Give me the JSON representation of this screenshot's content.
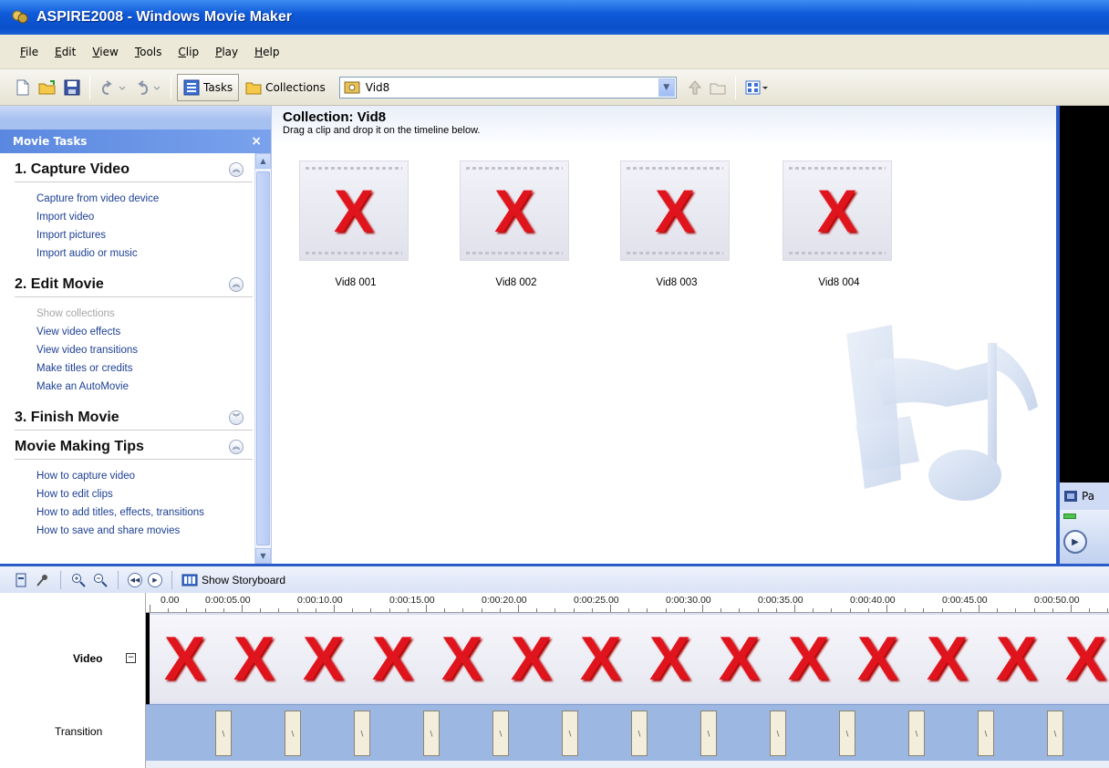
{
  "window": {
    "title": "ASPIRE2008 - Windows Movie Maker"
  },
  "menu": [
    "File",
    "Edit",
    "View",
    "Tools",
    "Clip",
    "Play",
    "Help"
  ],
  "toolbar": {
    "tasks_label": "Tasks",
    "collections_label": "Collections",
    "collection_select": "Vid8"
  },
  "taskpane": {
    "title": "Movie Tasks",
    "close_glyph": "×",
    "sections": [
      {
        "title": "1. Capture Video",
        "expanded": true,
        "links": [
          "Capture from video device",
          "Import video",
          "Import pictures",
          "Import audio or music"
        ]
      },
      {
        "title": "2. Edit Movie",
        "expanded": true,
        "links": [
          "Show collections",
          "View video effects",
          "View video transitions",
          "Make titles or credits",
          "Make an AutoMovie"
        ]
      },
      {
        "title": "3. Finish Movie",
        "expanded": false,
        "links": []
      },
      {
        "title": "Movie Making Tips",
        "expanded": true,
        "links": [
          "How to capture video",
          "How to edit clips",
          "How to add titles, effects, transitions",
          "How to save and share movies"
        ]
      }
    ]
  },
  "collection": {
    "title": "Collection: Vid8",
    "subtitle": "Drag a clip and drop it on the timeline below.",
    "clips": [
      "Vid8 001",
      "Vid8 002",
      "Vid8 003",
      "Vid8 004"
    ],
    "missing_glyph": "X"
  },
  "monitor": {
    "label": "Pa"
  },
  "timeline": {
    "show_storyboard_label": "Show Storyboard",
    "ruler": [
      "0.00",
      "0:00:05.00",
      "0:00:10.00",
      "0:00:15.00",
      "0:00:20.00",
      "0:00:25.00",
      "0:00:30.00",
      "0:00:35.00",
      "0:00:40.00",
      "0:00:45.00",
      "0:00:50.00"
    ],
    "video_label": "Video",
    "transition_label": "Transition",
    "clip_count": 14
  },
  "colors": {
    "title_bar": "#0f5ad9",
    "accent_blue": "#2a5bc9",
    "link_blue": "#1c3f94",
    "error_red": "#e0141c"
  }
}
